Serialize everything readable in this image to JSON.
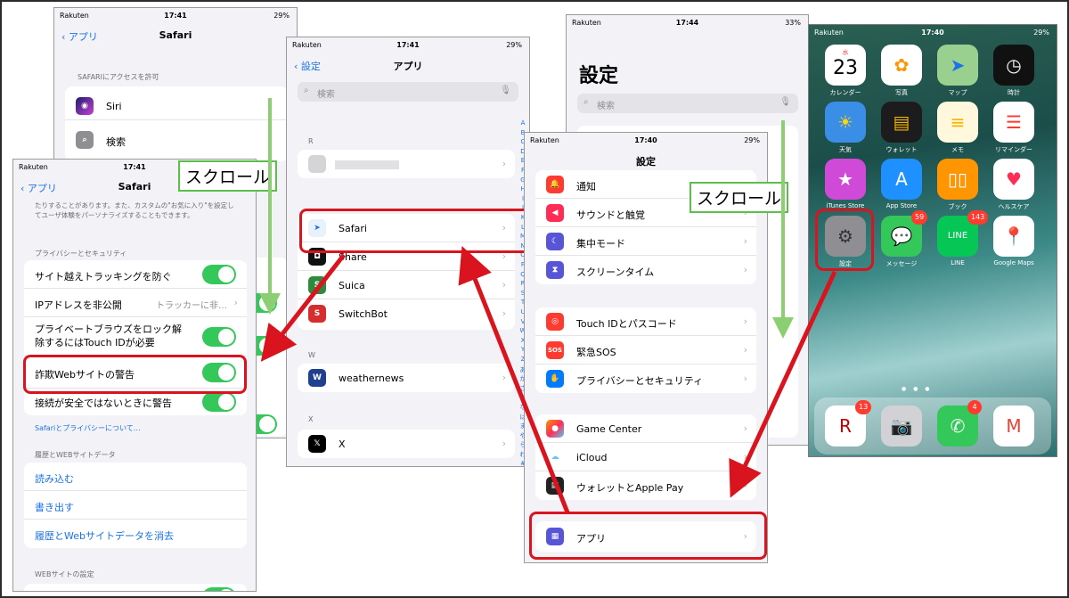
{
  "screen_b": {
    "status": {
      "carrier": "Rakuten",
      "time": "17:41",
      "battery": "29%"
    },
    "nav": {
      "back": "アプリ",
      "title": "Safari"
    },
    "section": "SAFARIにアクセスを許可",
    "items": [
      "Siri",
      "検索"
    ]
  },
  "screen_a": {
    "status": {
      "carrier": "Rakuten",
      "time": "17:41"
    },
    "nav": {
      "back": "アプリ",
      "title": "Safari"
    },
    "intro": "たりすることがあります。また、カスタムの\"お気に入り\"を設定してユーザ体験をパーソナライズすることもできます。",
    "privacy_header": "プライバシーとセキュリティ",
    "privacy_rows": [
      {
        "label": "サイト越えトラッキングを防ぐ"
      },
      {
        "label": "IPアドレスを非公開",
        "value": "トラッカーに非…"
      },
      {
        "label": "プライベートブラウズをロック解除するにはTouch IDが必要"
      },
      {
        "label": "詐欺Webサイトの警告"
      },
      {
        "label": "接続が安全ではないときに警告"
      }
    ],
    "privacy_link": "Safariとプライバシーについて…",
    "history_header": "履歴とWEBサイトデータ",
    "history_rows": [
      "読み込む",
      "書き出す",
      "履歴とWebサイトデータを消去"
    ],
    "website_header": "WEBサイトの設定"
  },
  "screen_c": {
    "status": {
      "carrier": "Rakuten",
      "time": "17:41",
      "battery": "29%"
    },
    "nav": {
      "back": "設定",
      "title": "アプリ"
    },
    "search_placeholder": "検索",
    "sections": [
      {
        "letter": "R",
        "apps": [
          ""
        ]
      },
      {
        "letter": "",
        "apps": [
          "Safari",
          "Share",
          "Suica",
          "SwitchBot"
        ]
      },
      {
        "letter": "W",
        "apps": [
          "weathernews"
        ]
      },
      {
        "letter": "X",
        "apps": [
          "X"
        ]
      }
    ],
    "index": [
      "A",
      "B",
      "C",
      "D",
      "E",
      "F",
      "G",
      "H",
      "I",
      "J",
      "K",
      "L",
      "M",
      "N",
      "O",
      "P",
      "Q",
      "R",
      "S",
      "T",
      "U",
      "V",
      "W",
      "X",
      "Y",
      "Z",
      "あ",
      "か",
      "さ",
      "た",
      "な",
      "は",
      "ま",
      "や",
      "ら",
      "わ",
      "#"
    ]
  },
  "screen_d": {
    "status": {
      "carrier": "Rakuten",
      "time": "17:44",
      "battery": "33%"
    },
    "large_title": "設定",
    "search_placeholder": "検索"
  },
  "screen_e": {
    "status": {
      "carrier": "Rakuten",
      "time": "17:40",
      "battery": "29%"
    },
    "title": "設定",
    "group1": [
      "通知",
      "サウンドと触覚",
      "集中モード",
      "スクリーンタイム"
    ],
    "group2": [
      "Touch IDとパスコード",
      "緊急SOS",
      "プライバシーとセキュリティ"
    ],
    "group3": [
      "Game Center",
      "iCloud",
      "ウォレットとApple Pay"
    ],
    "apps_row": "アプリ"
  },
  "home": {
    "status": {
      "carrier": "Rakuten",
      "time": "17:40",
      "battery": "29%"
    },
    "calendar": {
      "weekday": "水",
      "day": "23"
    },
    "apps": [
      {
        "label": "カレンダー"
      },
      {
        "label": "写真"
      },
      {
        "label": "マップ"
      },
      {
        "label": "時計"
      },
      {
        "label": "天気"
      },
      {
        "label": "ウォレット"
      },
      {
        "label": "メモ"
      },
      {
        "label": "リマインダー"
      },
      {
        "label": "iTunes Store"
      },
      {
        "label": "App Store"
      },
      {
        "label": "ブック"
      },
      {
        "label": "ヘルスケア"
      },
      {
        "label": "設定"
      },
      {
        "label": "メッセージ",
        "badge": "59"
      },
      {
        "label": "LINE",
        "badge": "143"
      },
      {
        "label": "Google Maps"
      }
    ],
    "dock": [
      {
        "label": "Rakuten Link",
        "badge": "13"
      },
      {
        "label": "カメラ"
      },
      {
        "label": "電話",
        "badge": "4"
      },
      {
        "label": "Gmail"
      }
    ]
  },
  "callouts": [
    "スクロール",
    "スクロール"
  ],
  "colors": {
    "highlight": "#d9141e",
    "arrow": "#d9141e",
    "callout_border": "#5cbf4b",
    "scroll_arrow": "#8ccf73",
    "toggle_on": "#34c759",
    "ios_blue": "#1a73e8"
  }
}
